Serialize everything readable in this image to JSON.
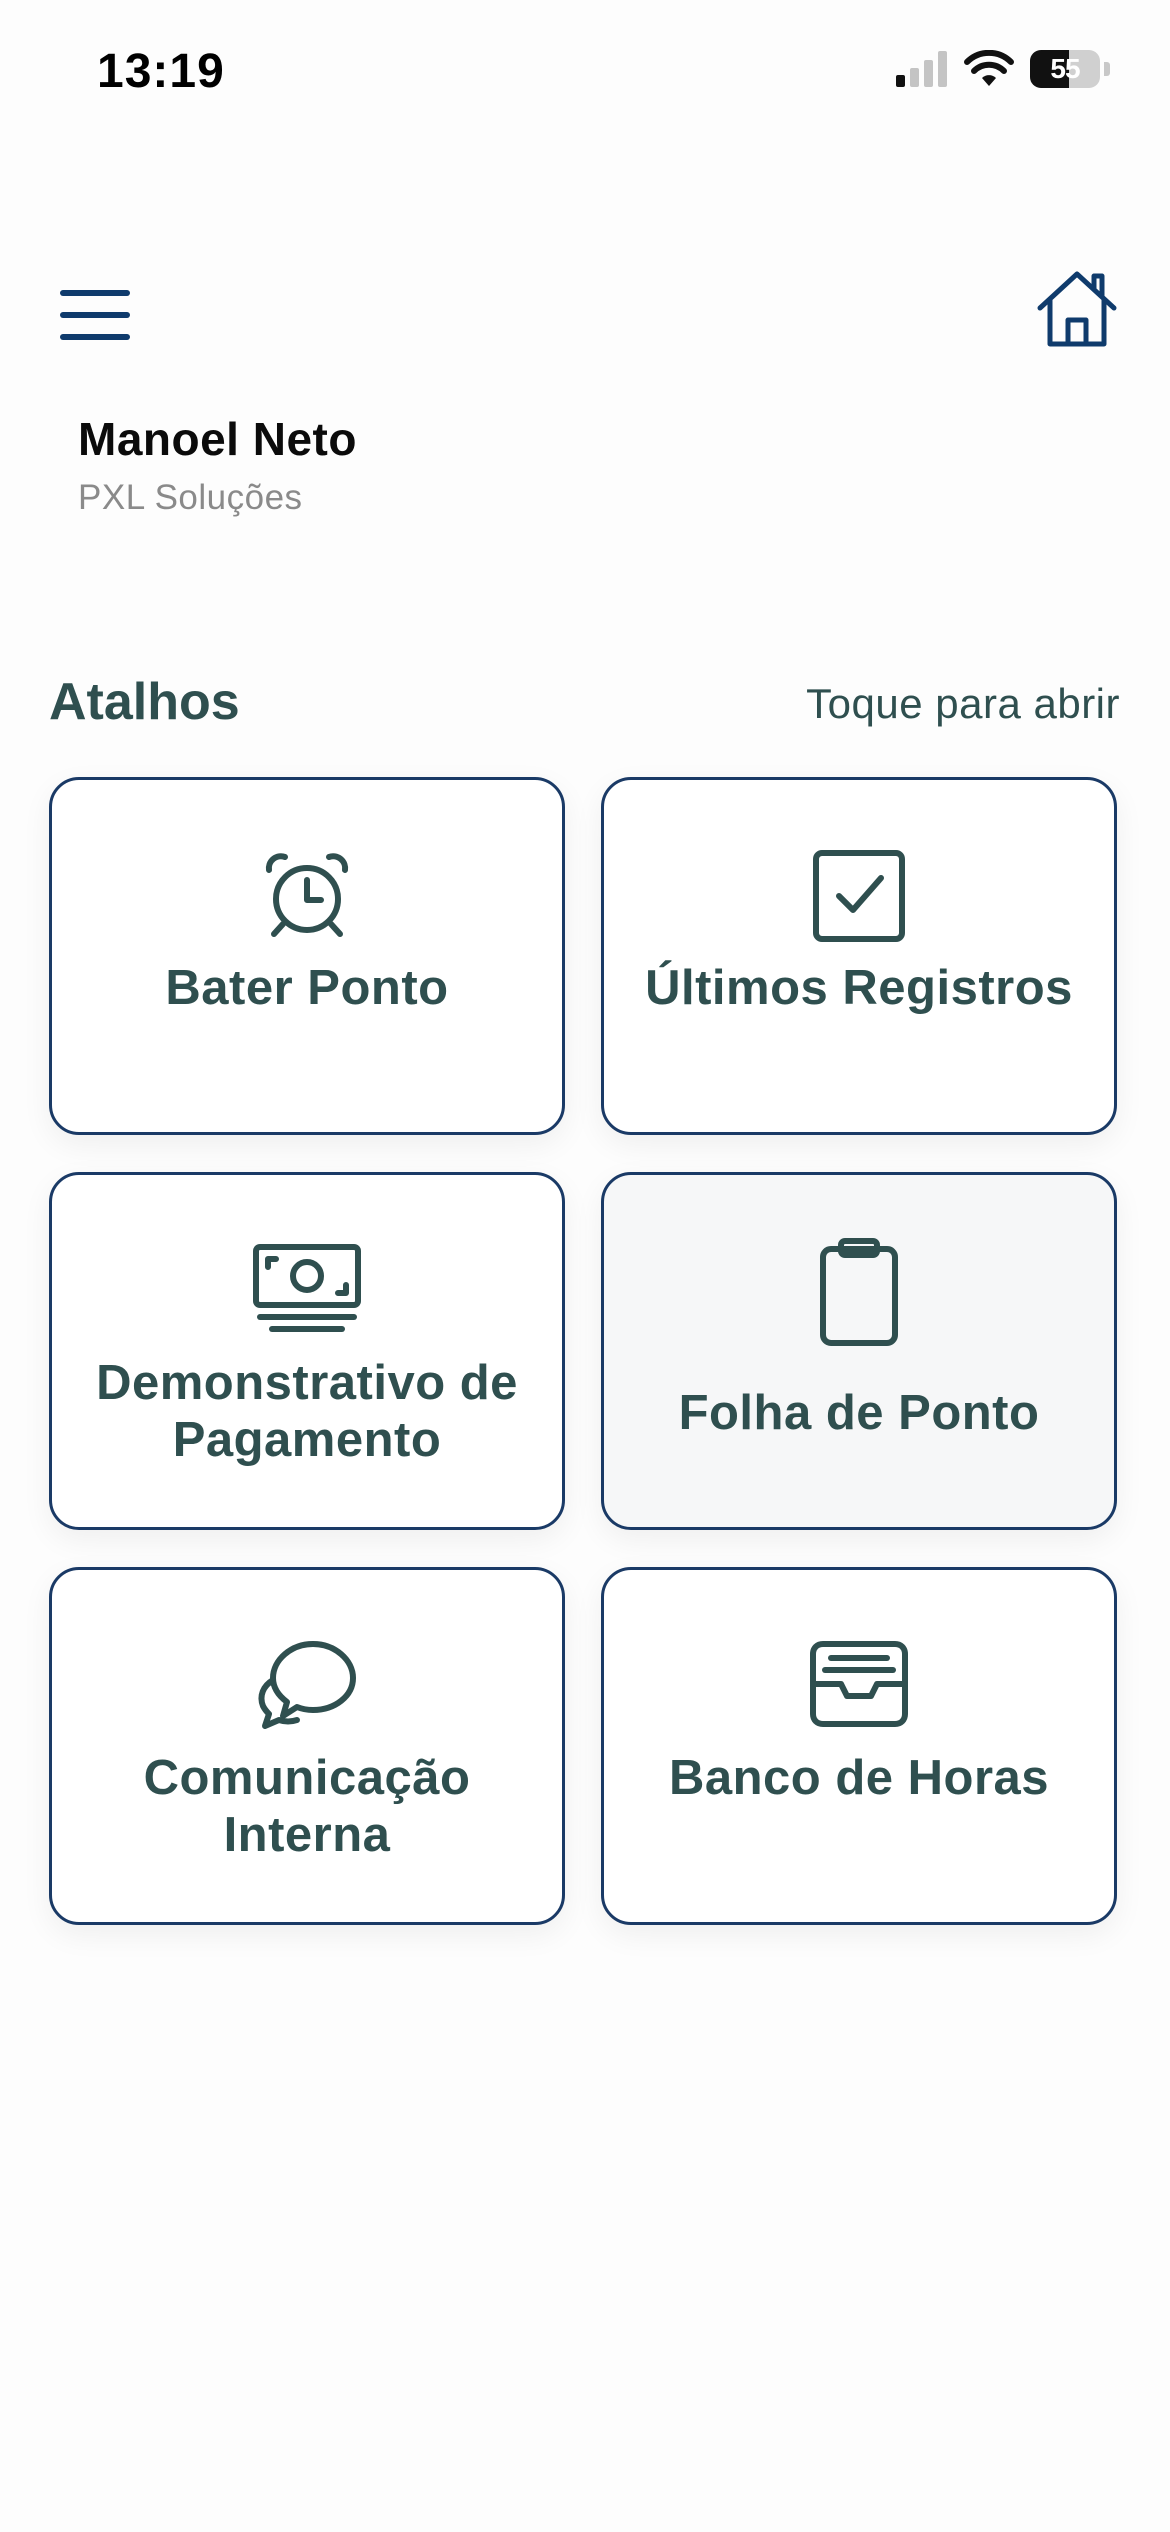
{
  "status_bar": {
    "time": "13:19",
    "battery_level": "55",
    "icons": [
      "cellular-signal-icon",
      "wifi-icon",
      "battery-icon"
    ]
  },
  "header": {
    "icons": [
      "menu-icon",
      "home-icon"
    ],
    "accent_color": "#0f3b6c"
  },
  "user": {
    "name": "Manoel Neto",
    "company": "PXL Soluções"
  },
  "shortcuts": {
    "title": "Atalhos",
    "hint": "Toque para abrir",
    "text_color": "#2f4f4f",
    "items": [
      {
        "label": "Bater Ponto",
        "icon": "alarm-clock-icon"
      },
      {
        "label": "Últimos Registros",
        "icon": "checkbox-icon"
      },
      {
        "label": "Demonstrativo de Pagamento",
        "icon": "money-icon"
      },
      {
        "label": "Folha de Ponto",
        "icon": "clipboard-icon"
      },
      {
        "label": "Comunicação Interna",
        "icon": "chat-bubbles-icon"
      },
      {
        "label": "Banco de Horas",
        "icon": "inbox-tray-icon"
      }
    ]
  }
}
